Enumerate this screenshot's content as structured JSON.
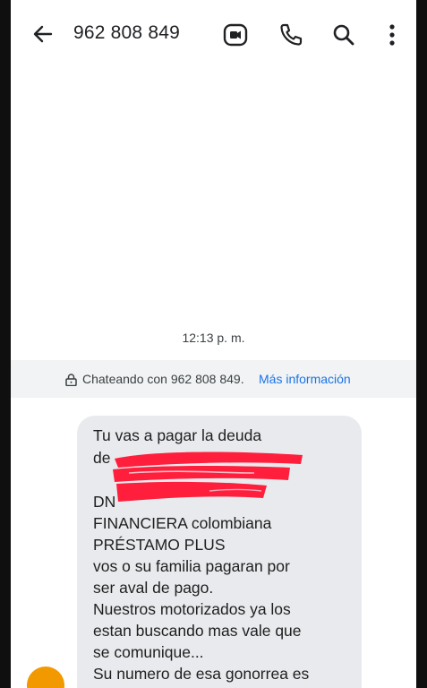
{
  "header": {
    "phone_number": "962 808 849",
    "icons": [
      "back-arrow-icon",
      "video-call-icon",
      "phone-icon",
      "search-icon",
      "more-vert-icon"
    ]
  },
  "conversation": {
    "timestamp": "12:13 p. m.",
    "chatting_text": "Chateando con 962 808 849.",
    "more_info_link": "Más información"
  },
  "message": {
    "lines": [
      "Tu vas a pagar la deuda",
      "de",
      "DN",
      " FINANCIERA  colombiana",
      "PRÉSTAMO PLUS",
      "vos o su familia pagaran por",
      "ser aval de pago.",
      "Nuestros motorizados ya los",
      "estan buscando mas vale que",
      "se comunique...",
      "Su numero de esa gonorrea es"
    ]
  },
  "colors": {
    "bubble": "#e8eaed",
    "link": "#1a73e8",
    "redaction": "#ff1f3d",
    "avatar": "#f29900"
  }
}
